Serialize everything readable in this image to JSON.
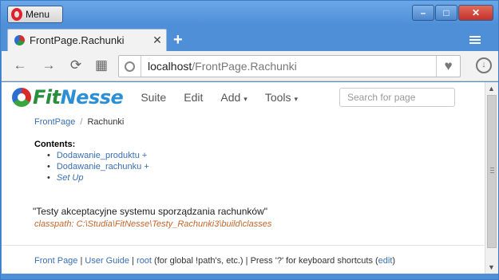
{
  "window": {
    "menu_label": "Menu",
    "controls": {
      "minimize": "–",
      "maximize": "□",
      "close": "✕"
    }
  },
  "tab": {
    "title": "FrontPage.Rachunki",
    "close": "✕",
    "new_tab": "+"
  },
  "toolbar": {
    "back": "←",
    "forward": "→",
    "reload": "⟳",
    "speed_dial": "▦",
    "address_host": "localhost",
    "address_path": "/FrontPage.Rachunki",
    "bookmark": "♥",
    "download": "↓"
  },
  "fitnesse": {
    "logo_fit": "Fit",
    "logo_nesse": "Nesse",
    "nav": {
      "suite": "Suite",
      "edit": "Edit",
      "add": "Add",
      "tools": "Tools"
    },
    "search_placeholder": "Search for page"
  },
  "breadcrumb": {
    "parent": "FrontPage",
    "separator": "/",
    "current": "Rachunki"
  },
  "contents": {
    "title": "Contents:",
    "items": [
      {
        "label": "Dodawanie_produktu +"
      },
      {
        "label": "Dodawanie_rachunku +"
      },
      {
        "label": "Set Up"
      }
    ]
  },
  "description": "\"Testy akceptacyjne systemu sporządzania rachunków\"",
  "classpath": "classpath: C:\\Studia\\FitNesse\\Testy_Rachunki3\\build\\classes",
  "footer": {
    "front_page": "Front Page",
    "sep": " | ",
    "user_guide": "User Guide",
    "root": "root",
    "root_note": " (for global !path's, etc.) | Press '?' for keyboard shortcuts (",
    "edit": "edit",
    "close_paren": ")"
  },
  "colors": {
    "link": "#3a6fb0",
    "classpath": "#c0662d",
    "frame": "#4f8fd8"
  }
}
